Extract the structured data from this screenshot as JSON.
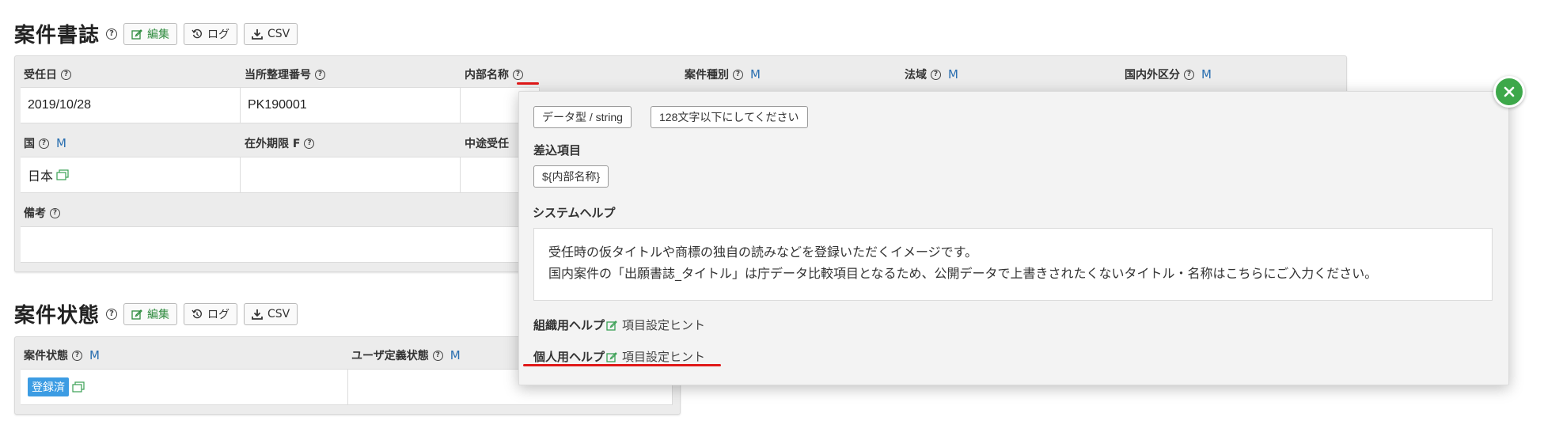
{
  "section1": {
    "title": "案件書誌",
    "buttons": {
      "edit": "編集",
      "log": "ログ",
      "csv": "CSV"
    },
    "fields": [
      {
        "label": "受任日",
        "value": "2019/10/28",
        "master": false
      },
      {
        "label": "当所整理番号",
        "value": "PK190001",
        "master": false
      },
      {
        "label": "内部名称",
        "value": "",
        "master": false
      },
      {
        "label": "案件種別",
        "value": "",
        "master": true
      },
      {
        "label": "法域",
        "value": "",
        "master": true
      },
      {
        "label": "国内外区分",
        "value": "",
        "master": true
      }
    ],
    "row2": [
      {
        "label": "国",
        "value": "日本",
        "master": true
      },
      {
        "label": "在外期限 F",
        "value": "",
        "master": false
      },
      {
        "label": "中途受任",
        "value": ""
      }
    ],
    "remarks_label": "備考",
    "master_marker": "M"
  },
  "section2": {
    "title": "案件状態",
    "buttons": {
      "edit": "編集",
      "log": "ログ",
      "csv": "CSV"
    },
    "fields": [
      {
        "label": "案件状態",
        "value": "登録済",
        "master": true
      },
      {
        "label": "ユーザ定義状態",
        "value": "",
        "master": true
      }
    ]
  },
  "popover": {
    "type_tag": "データ型 / string",
    "limit_tag": "128文字以下にしてください",
    "insert_heading": "差込項目",
    "insert_tag": "${内部名称}",
    "system_help_heading": "システムヘルプ",
    "system_help_lines": [
      "受任時の仮タイトルや商標の独自の読みなどを登録いただくイメージです。",
      "国内案件の「出願書誌_タイトル」は庁データ比較項目となるため、公開データで上書きされたくないタイトル・名称はこちらにご入力ください。"
    ],
    "org_help_label": "組織用ヘルプ",
    "org_help_link": "項目設定ヒント",
    "personal_help_label": "個人用ヘルプ",
    "personal_help_link": "項目設定ヒント"
  },
  "colors": {
    "master": "#2a6fb0",
    "edit_green": "#2e8b3e",
    "close_green": "#3da84a",
    "highlight_red": "#e01818",
    "status_blue": "#3c9ce3"
  }
}
